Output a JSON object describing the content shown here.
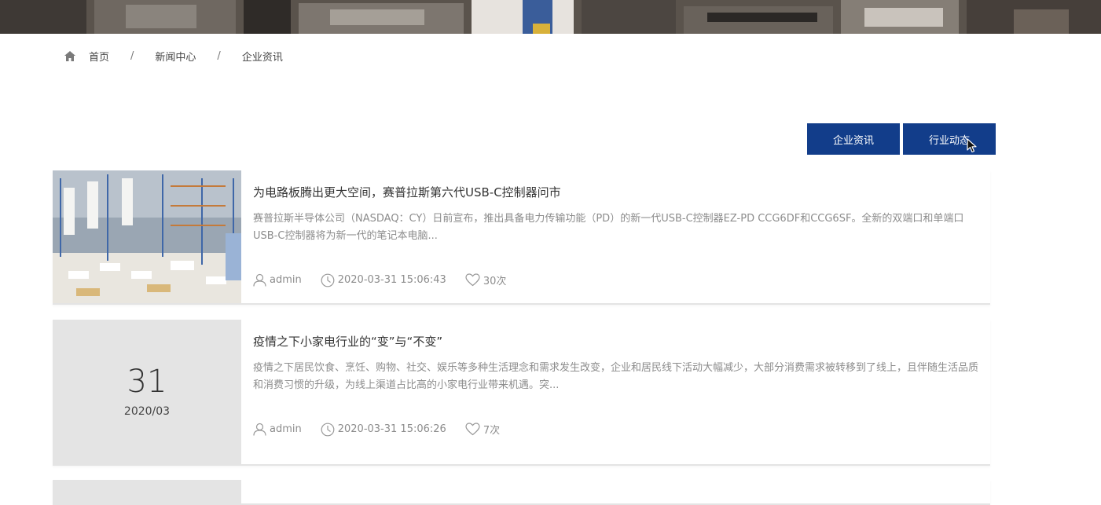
{
  "breadcrumb": {
    "home_icon": "home-icon",
    "items": [
      "首页",
      "新闻中心",
      "企业资讯"
    ],
    "separator": "/"
  },
  "tabs": [
    {
      "label": "企业资讯"
    },
    {
      "label": "行业动态"
    }
  ],
  "colors": {
    "tab_bg": "#123d8a",
    "date_block_bg": "#e4e4e4",
    "summary_text": "#8c8c8c"
  },
  "news": [
    {
      "title": "为电路板腾出更大空间，赛普拉斯第六代USB-C控制器问市",
      "summary": "赛普拉斯半导体公司（NASDAQ：CY）日前宣布，推出具备电力传输功能（PD）的新一代USB-C控制器EZ-PD CCG6DF和CCG6SF。全新的双端口和单端口USB-C控制器将为新一代的笔记本电脑...",
      "author": "admin",
      "datetime": "2020-03-31 15:06:43",
      "likes": "30次",
      "thumbnail": "warehouse-photo"
    },
    {
      "title": "疫情之下小家电行业的“变”与“不变”",
      "summary": "疫情之下居民饮食、烹饪、购物、社交、娱乐等多种生活理念和需求发生改变，企业和居民线下活动大幅减少，大部分消费需求被转移到了线上，且伴随生活品质和消费习惯的升级，为线上渠道占比高的小家电行业带来机遇。突...",
      "author": "admin",
      "datetime": "2020-03-31 15:06:26",
      "likes": "7次",
      "date_day": "31",
      "date_ym": "2020/03"
    }
  ],
  "icons": {
    "author": "user-icon",
    "time": "clock-icon",
    "likes": "heart-icon",
    "cursor": "mouse-cursor-icon"
  }
}
